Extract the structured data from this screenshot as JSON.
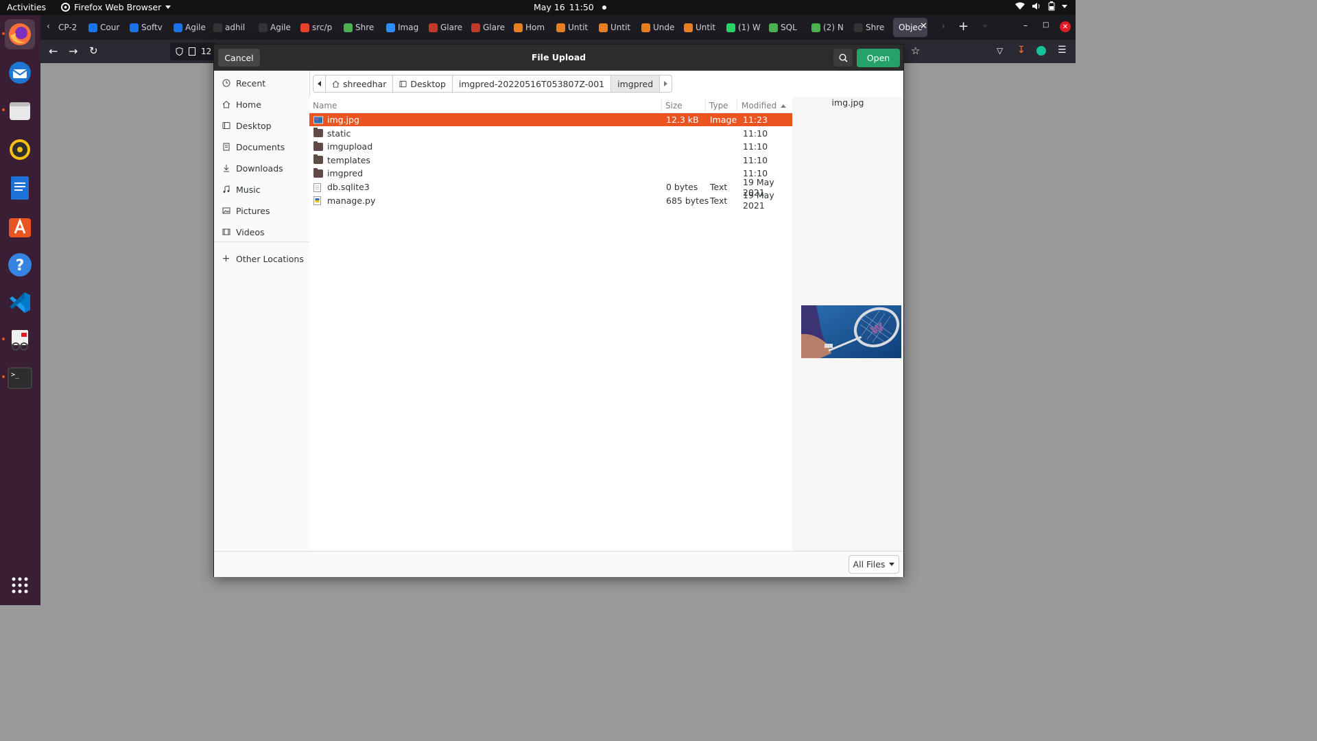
{
  "topbar": {
    "activities": "Activities",
    "app_name": "Firefox Web Browser",
    "date": "May 16",
    "time": "11:50"
  },
  "browser": {
    "tabs": [
      {
        "label": "CP-2",
        "color": "#1c1b22"
      },
      {
        "label": "Cour",
        "color": "#1a73e8"
      },
      {
        "label": "Softv",
        "color": "#1a73e8"
      },
      {
        "label": "Agile",
        "color": "#1a73e8"
      },
      {
        "label": "adhil",
        "color": "#333333"
      },
      {
        "label": "Agile",
        "color": "#333333"
      },
      {
        "label": "src/p",
        "color": "#e24329"
      },
      {
        "label": "Shre",
        "color": "#4caf50"
      },
      {
        "label": "Imag",
        "color": "#2d8cff"
      },
      {
        "label": "Glare",
        "color": "#c0392b"
      },
      {
        "label": "Glare",
        "color": "#c0392b"
      },
      {
        "label": "Hom",
        "color": "#e67e22"
      },
      {
        "label": "Untit",
        "color": "#e67e22"
      },
      {
        "label": "Untit",
        "color": "#e67e22"
      },
      {
        "label": "Unde",
        "color": "#e67e22"
      },
      {
        "label": "Untit",
        "color": "#e67e22"
      },
      {
        "label": "(1) W",
        "color": "#25d366"
      },
      {
        "label": "SQL",
        "color": "#4caf50"
      },
      {
        "label": "(2) N",
        "color": "#4caf50"
      },
      {
        "label": "Shre",
        "color": "#333333"
      },
      {
        "label": "Objec",
        "color": "#42414d"
      }
    ],
    "url_partial": "12"
  },
  "dialog": {
    "title": "File Upload",
    "cancel_label": "Cancel",
    "open_label": "Open",
    "places": [
      {
        "label": "Recent",
        "icon": "clock-icon"
      },
      {
        "label": "Home",
        "icon": "home-icon"
      },
      {
        "label": "Desktop",
        "icon": "desktop-icon"
      },
      {
        "label": "Documents",
        "icon": "document-icon"
      },
      {
        "label": "Downloads",
        "icon": "download-icon"
      },
      {
        "label": "Music",
        "icon": "music-icon"
      },
      {
        "label": "Pictures",
        "icon": "picture-icon"
      },
      {
        "label": "Videos",
        "icon": "video-icon"
      }
    ],
    "other_locations": "Other Locations",
    "path": [
      "shreedhar",
      "Desktop",
      "imgpred-20220516T053807Z-001",
      "imgpred"
    ],
    "columns": {
      "name": "Name",
      "size": "Size",
      "type": "Type",
      "modified": "Modified"
    },
    "files": [
      {
        "name": "img.jpg",
        "size": "12.3 kB",
        "type": "Image",
        "modified": "11:23",
        "kind": "image",
        "selected": true
      },
      {
        "name": "static",
        "size": "",
        "type": "",
        "modified": "11:10",
        "kind": "folder"
      },
      {
        "name": "imgupload",
        "size": "",
        "type": "",
        "modified": "11:10",
        "kind": "folder"
      },
      {
        "name": "templates",
        "size": "",
        "type": "",
        "modified": "11:10",
        "kind": "folder"
      },
      {
        "name": "imgpred",
        "size": "",
        "type": "",
        "modified": "11:10",
        "kind": "folder"
      },
      {
        "name": "db.sqlite3",
        "size": "0 bytes",
        "type": "Text",
        "modified": "19 May 2021",
        "kind": "text"
      },
      {
        "name": "manage.py",
        "size": "685 bytes",
        "type": "Text",
        "modified": "19 May 2021",
        "kind": "script"
      }
    ],
    "preview_name": "img.jpg",
    "filter_label": "All Files"
  },
  "colors": {
    "selection": "#e95420",
    "open_button": "#26a269",
    "dock": "#3a1f34"
  }
}
